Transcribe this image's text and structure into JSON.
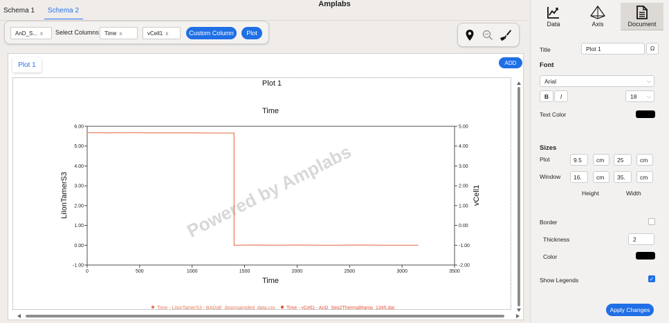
{
  "app": {
    "title": "Amplabs"
  },
  "schema_tabs": [
    {
      "label": "Schema 1",
      "active": false
    },
    {
      "label": "Schema 2",
      "active": true
    }
  ],
  "toolbar": {
    "file_chip": "AnD_S...",
    "select_columns_label": "Select Columns :",
    "column_chips": [
      "Time",
      "vCell1"
    ],
    "custom_column_button": "Custom Column",
    "plot_button": "Plot"
  },
  "tools": [
    "location-pin-icon",
    "zoom-out-icon",
    "brush-icon"
  ],
  "plot_panel": {
    "tab_label": "Plot 1",
    "add_button": "ADD"
  },
  "chart_data": {
    "type": "line",
    "title": "Plot 1",
    "subtitle": "Time",
    "xlabel": "Time",
    "ylabel": "LiIonTamerS3",
    "y2label": "vCell1",
    "xlim": [
      0,
      3500
    ],
    "ylim": [
      -1.0,
      6.0
    ],
    "y2lim": [
      -2.0,
      5.0
    ],
    "x_ticks": [
      "0",
      "500",
      "1000",
      "1500",
      "2000",
      "2500",
      "3000",
      "3500"
    ],
    "y_ticks": [
      "6.00",
      "5.00",
      "4.00",
      "3.00",
      "2.00",
      "1.00",
      "0.00",
      "-1.00"
    ],
    "y2_ticks": [
      "5.00",
      "4.00",
      "3.00",
      "2.00",
      "1.00",
      "0.00",
      "-1.00",
      "-2.00"
    ],
    "watermark": "Powered by Amplabs",
    "series": [
      {
        "name": "Time - LiIonTamerS3 - BADgE_downsampled_data.csv",
        "color": "#e87a55",
        "x": [
          0,
          200,
          400,
          600,
          800,
          1000,
          1200,
          1400,
          1400,
          1600,
          1800,
          2000,
          2200,
          2400,
          2600,
          2800,
          3000,
          3150
        ],
        "y": [
          5.68,
          5.67,
          5.68,
          5.67,
          5.67,
          5.67,
          5.66,
          5.66,
          0.0,
          0.01,
          0.0,
          0.01,
          0.0,
          0.0,
          0.01,
          0.0,
          0.0,
          0.0
        ]
      },
      {
        "name": "Time - vCell1 - AnD_Seq2ThermalRamp_1345.dat",
        "color": "#e9563b",
        "x": [
          0,
          3150
        ],
        "y": [
          null,
          null
        ]
      }
    ],
    "legend_position": "bottom-center",
    "grid": false
  },
  "right_panel": {
    "tabs": [
      {
        "label": "Data",
        "icon": "line-chart-icon",
        "active": false
      },
      {
        "label": "Axis",
        "icon": "pyramid-icon",
        "active": false
      },
      {
        "label": "Document",
        "icon": "document-icon",
        "active": true
      }
    ],
    "title_label": "Title",
    "title_value": "Plot 1",
    "omega_symbol": "Ω",
    "font_heading": "Font",
    "font_family": "Arial",
    "bold_label": "B",
    "italic_label": "I",
    "font_size": "18",
    "text_color_label": "Text Color",
    "text_color": "#000000",
    "sizes_heading": "Sizes",
    "plot_label": "Plot",
    "plot_height": "9.5",
    "plot_width": "25",
    "window_label": "Window",
    "window_height": "16.",
    "window_width": "35.",
    "unit": "cm",
    "height_label": "Height",
    "width_label": "Width",
    "border_label": "Border",
    "border_checked": false,
    "thickness_label": "Thickness",
    "thickness_value": "2",
    "color_label": "Color",
    "border_color": "#000000",
    "show_legends_label": "Show Legends",
    "show_legends_checked": true,
    "apply_button": "Apply Changes"
  }
}
